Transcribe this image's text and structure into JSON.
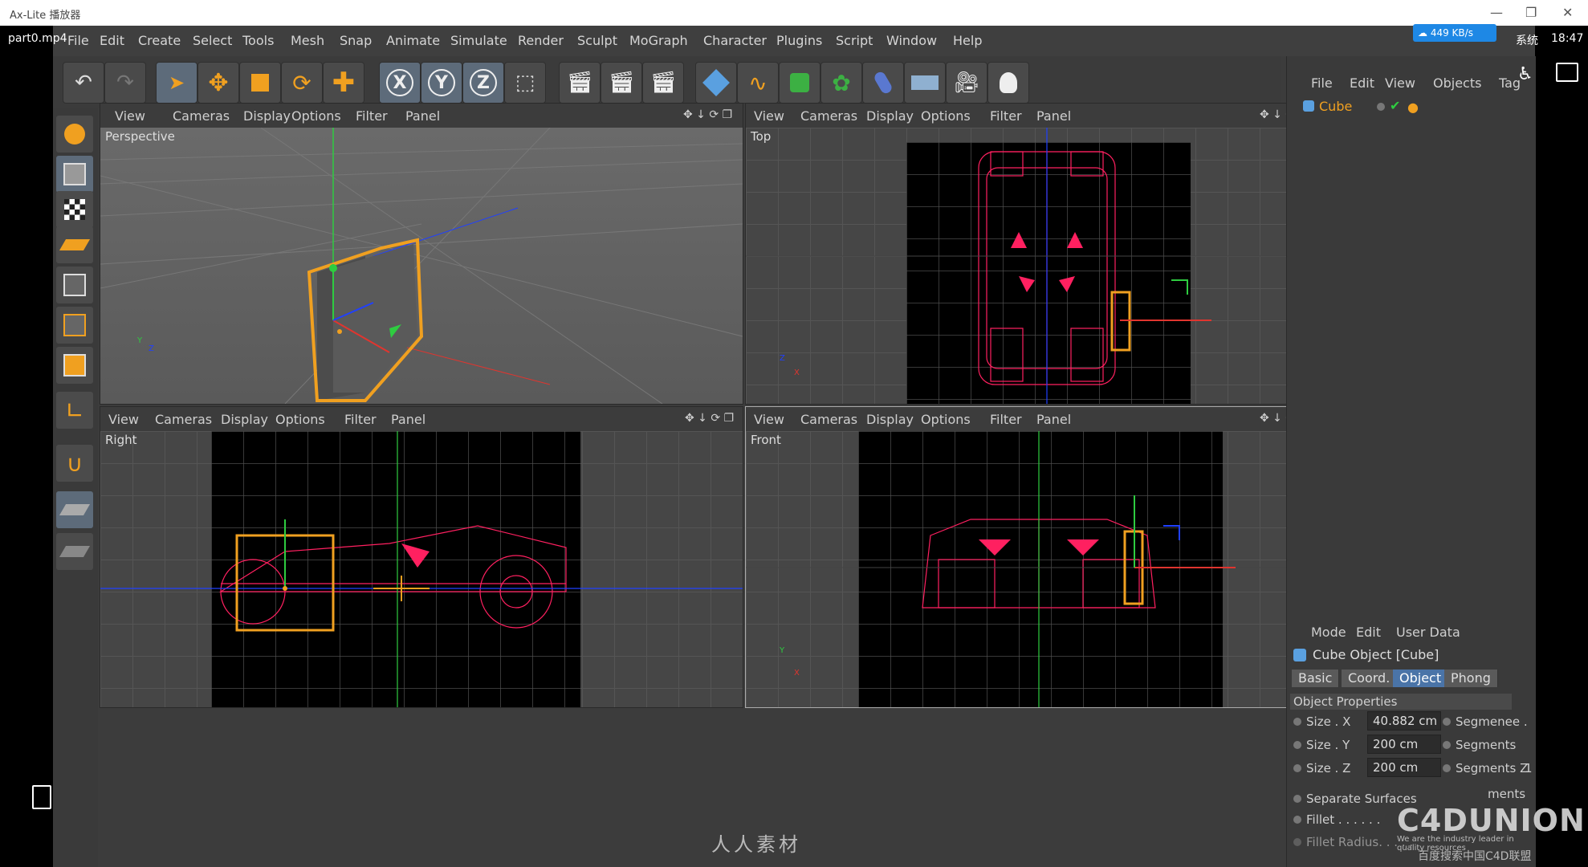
{
  "player": {
    "title": "Ax-Lite 播放器",
    "filename": "part0.mp4",
    "system_label": "系统",
    "clock": "18:47",
    "speed": "449 KB/s"
  },
  "menubar": {
    "items": [
      "File",
      "Edit",
      "Create",
      "Select",
      "Tools",
      "Mesh",
      "Snap",
      "Animate",
      "Simulate",
      "Render",
      "Sculpt",
      "MoGraph",
      "Character",
      "Plugins",
      "Script",
      "Window",
      "Help"
    ]
  },
  "toolbar": {
    "axis_x": "X",
    "axis_y": "Y",
    "axis_z": "Z"
  },
  "viewport_menu": {
    "items": [
      "View",
      "Cameras",
      "Display",
      "Options",
      "Filter",
      "Panel"
    ]
  },
  "viewports": {
    "perspective": "Perspective",
    "top": "Top",
    "right": "Right",
    "front": "Front"
  },
  "axis_labels": {
    "x": "X",
    "y": "Y",
    "z": "Z"
  },
  "object_manager": {
    "menu": [
      "File",
      "Edit",
      "View",
      "Objects",
      "Tag"
    ],
    "object_name": "Cube"
  },
  "attribute_manager": {
    "menu": [
      "Mode",
      "Edit",
      "User Data"
    ],
    "title": "Cube Object [Cube]",
    "tabs": [
      "Basic",
      "Coord.",
      "Object",
      "Phong"
    ],
    "active_tab": "Object",
    "section": "Object Properties",
    "size_x_label": "Size . X",
    "size_x_value": "40.882 cm",
    "size_y_label": "Size . Y",
    "size_y_value": "200 cm",
    "size_z_label": "Size . Z",
    "size_z_value": "200 cm",
    "seg_x_label": "Segmenee .",
    "seg_y_label": "Segments",
    "seg_z_label": "Segments Z",
    "seg_z_value": "1",
    "separate_surfaces": "Separate Surfaces",
    "fillet": "Fillet . . . . . .",
    "fillet_radius": "Fillet Radius. . . . .",
    "seg_tail": "ments"
  },
  "watermarks": {
    "center": "人人素材",
    "brand": "C4DUNION",
    "tagline": "We are the industry leader in quality resources",
    "search": "百度搜索中国C4D联盟"
  },
  "colors": {
    "accent_orange": "#f0a020",
    "wire_pink": "#ff2060",
    "axis_green": "#2ecc40",
    "axis_red": "#e0352f",
    "axis_blue": "#2040ff",
    "selected_tab": "#4a74a8"
  }
}
